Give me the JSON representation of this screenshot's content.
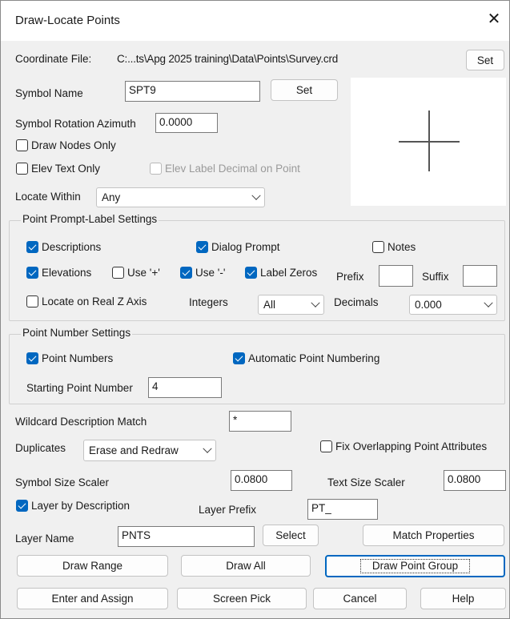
{
  "window": {
    "title": "Draw-Locate Points",
    "close_glyph": "✕"
  },
  "coordinate_file": {
    "label": "Coordinate File:",
    "path": "C:...ts\\Apg 2025 training\\Data\\Points\\Survey.crd",
    "set_label": "Set"
  },
  "symbol": {
    "name_label": "Symbol Name",
    "name_value": "SPT9",
    "set_label": "Set",
    "rotation_label": "Symbol Rotation Azimuth",
    "rotation_value": "0.0000"
  },
  "options": {
    "draw_nodes_only": {
      "label": "Draw Nodes Only",
      "checked": false
    },
    "elev_text_only": {
      "label": "Elev Text Only",
      "checked": false
    },
    "elev_label_decimal": {
      "label": "Elev Label Decimal on Point",
      "checked": false,
      "disabled": true
    }
  },
  "locate_within": {
    "label": "Locate Within",
    "value": "Any"
  },
  "prompt_label": {
    "title": "Point Prompt-Label Settings",
    "descriptions": {
      "label": "Descriptions",
      "checked": true
    },
    "dialog_prompt": {
      "label": "Dialog Prompt",
      "checked": true
    },
    "notes": {
      "label": "Notes",
      "checked": false
    },
    "elevations": {
      "label": "Elevations",
      "checked": true
    },
    "use_plus": {
      "label": "Use '+'",
      "checked": false
    },
    "use_minus": {
      "label": "Use '-'",
      "checked": true
    },
    "label_zeros": {
      "label": "Label Zeros",
      "checked": true
    },
    "prefix_label": "Prefix",
    "prefix_value": "",
    "suffix_label": "Suffix",
    "suffix_value": "",
    "locate_real_z": {
      "label": "Locate on Real Z Axis",
      "checked": false
    },
    "integers_label": "Integers",
    "integers_value": "All",
    "decimals_label": "Decimals",
    "decimals_value": "0.000"
  },
  "point_number": {
    "title": "Point Number Settings",
    "point_numbers": {
      "label": "Point Numbers",
      "checked": true
    },
    "auto_numbering": {
      "label": "Automatic Point Numbering",
      "checked": true
    },
    "start_label": "Starting Point Number",
    "start_value": "4"
  },
  "wildcard": {
    "label": "Wildcard Description Match",
    "value": "*"
  },
  "duplicates": {
    "label": "Duplicates",
    "value": "Erase and Redraw"
  },
  "fix_overlapping": {
    "label": "Fix Overlapping Point Attributes",
    "checked": false
  },
  "symbol_size": {
    "label": "Symbol Size Scaler",
    "value": "0.0800"
  },
  "text_size": {
    "label": "Text Size Scaler",
    "value": "0.0800"
  },
  "layer_by_desc": {
    "label": "Layer by Description",
    "checked": true
  },
  "layer_prefix": {
    "label": "Layer Prefix",
    "value": "PT_"
  },
  "layer_name": {
    "label": "Layer Name",
    "value": "PNTS",
    "select_label": "Select",
    "match_label": "Match Properties"
  },
  "buttons": {
    "draw_range": "Draw Range",
    "draw_all": "Draw All",
    "draw_point_group": "Draw Point Group",
    "enter_assign": "Enter and Assign",
    "screen_pick": "Screen Pick",
    "cancel": "Cancel",
    "help": "Help"
  },
  "colors": {
    "accent": "#0067c0",
    "dialog_bg": "#f0f0f0",
    "titlebar_bg": "#ffffff"
  }
}
